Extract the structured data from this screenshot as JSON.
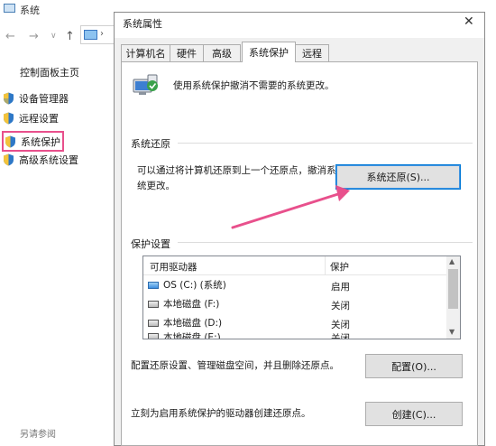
{
  "background_window": {
    "title": "系统",
    "sidebar": {
      "home": "控制面板主页",
      "items": [
        {
          "label": "设备管理器"
        },
        {
          "label": "远程设置"
        },
        {
          "label": "系统保护"
        },
        {
          "label": "高级系统设置"
        }
      ]
    },
    "see_also": "另请参阅"
  },
  "dialog": {
    "title": "系统属性",
    "close": "✕",
    "tabs": [
      {
        "label": "计算机名"
      },
      {
        "label": "硬件"
      },
      {
        "label": "高级"
      },
      {
        "label": "系统保护",
        "selected": true
      },
      {
        "label": "远程"
      }
    ],
    "intro": "使用系统保护撤消不需要的系统更改。",
    "restore": {
      "heading": "系统还原",
      "description": "可以通过将计算机还原到上一个还原点，撤消系统更改。",
      "button": "系统还原(S)..."
    },
    "protection": {
      "heading": "保护设置",
      "columns": [
        "可用驱动器",
        "保护"
      ],
      "rows": [
        {
          "drive": "OS (C:) (系统)",
          "protection": "启用",
          "icon": "os-drive-icon"
        },
        {
          "drive": "本地磁盘 (F:)",
          "protection": "关闭",
          "icon": "drive-icon"
        },
        {
          "drive": "本地磁盘 (D:)",
          "protection": "关闭",
          "icon": "drive-icon"
        },
        {
          "drive": "本地磁盘 (E:)",
          "protection": "关闭",
          "icon": "drive-icon"
        }
      ]
    },
    "configure": {
      "description": "配置还原设置、管理磁盘空间，并且删除还原点。",
      "button": "配置(O)..."
    },
    "create": {
      "description": "立刻为启用系统保护的驱动器创建还原点。",
      "button": "创建(C)..."
    }
  },
  "colors": {
    "highlight_box": "#e8508c",
    "arrow": "#e8508c",
    "focus_border": "#0078d7",
    "dialog_bg": "#f0f0f0"
  }
}
